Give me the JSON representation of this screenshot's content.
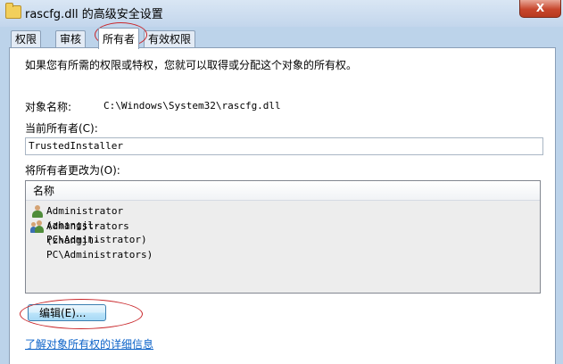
{
  "window": {
    "title": "rascfg.dll 的高级安全设置",
    "close_label": "X"
  },
  "tabs": [
    {
      "label": "权限"
    },
    {
      "label": "审核"
    },
    {
      "label": "所有者"
    },
    {
      "label": "有效权限"
    }
  ],
  "owner_page": {
    "description": "如果您有所需的权限或特权，您就可以取得或分配这个对象的所有权。",
    "object_name_label": "对象名称:",
    "object_name_value": "C:\\Windows\\System32\\rascfg.dll",
    "current_owner_label": "当前所有者(C):",
    "current_owner_value": "TrustedInstaller",
    "change_owner_label": "将所有者更改为(O):",
    "list_header": "名称",
    "list_items": [
      {
        "name": "Administrator (zhangjl-PC\\Administrator)",
        "icon": "user-icon"
      },
      {
        "name": "Administrators (zhangjl-PC\\Administrators)",
        "icon": "users-icon"
      }
    ],
    "edit_button": "编辑(E)...",
    "learn_more_link": "了解对象所有权的详细信息"
  },
  "colors": {
    "annotation_circle": "#c9262a",
    "link": "#0b62c8"
  }
}
